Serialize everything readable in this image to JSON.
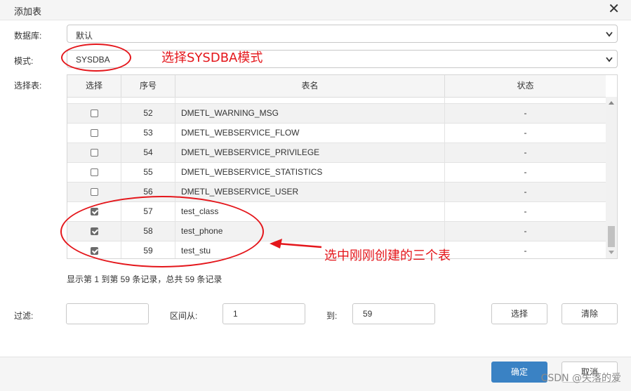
{
  "dialog": {
    "title": "添加表",
    "close": "✕"
  },
  "form": {
    "database_label": "数据库:",
    "database_value": "默认",
    "schema_label": "模式:",
    "schema_value": "SYSDBA",
    "table_label": "选择表:"
  },
  "annotations": {
    "schema_note": "选择SYSDBA模式",
    "rows_note": "选中刚刚创建的三个表"
  },
  "table": {
    "headers": [
      "选择",
      "序号",
      "表名",
      "状态"
    ],
    "rows": [
      {
        "no": "52",
        "name": "DMETL_WARNING_MSG",
        "status": "-",
        "checked": false
      },
      {
        "no": "53",
        "name": "DMETL_WEBSERVICE_FLOW",
        "status": "-",
        "checked": false
      },
      {
        "no": "54",
        "name": "DMETL_WEBSERVICE_PRIVILEGE",
        "status": "-",
        "checked": false
      },
      {
        "no": "55",
        "name": "DMETL_WEBSERVICE_STATISTICS",
        "status": "-",
        "checked": false
      },
      {
        "no": "56",
        "name": "DMETL_WEBSERVICE_USER",
        "status": "-",
        "checked": false
      },
      {
        "no": "57",
        "name": "test_class",
        "status": "-",
        "checked": true
      },
      {
        "no": "58",
        "name": "test_phone",
        "status": "-",
        "checked": true
      },
      {
        "no": "59",
        "name": "test_stu",
        "status": "-",
        "checked": true
      }
    ]
  },
  "pagination_text": "显示第 1 到第 59 条记录，总共 59 条记录",
  "filter": {
    "filter_label": "过滤:",
    "filter_value": "",
    "range_from_label": "区间从:",
    "range_from_value": "1",
    "range_to_label": "到:",
    "range_to_value": "59",
    "select_button": "选择",
    "clear_button": "清除"
  },
  "footer": {
    "ok": "确定",
    "cancel": "取消"
  },
  "watermark": "CSDN @失落的爱",
  "colors": {
    "annotation": "#e4161b",
    "primary": "#3a82c4"
  }
}
